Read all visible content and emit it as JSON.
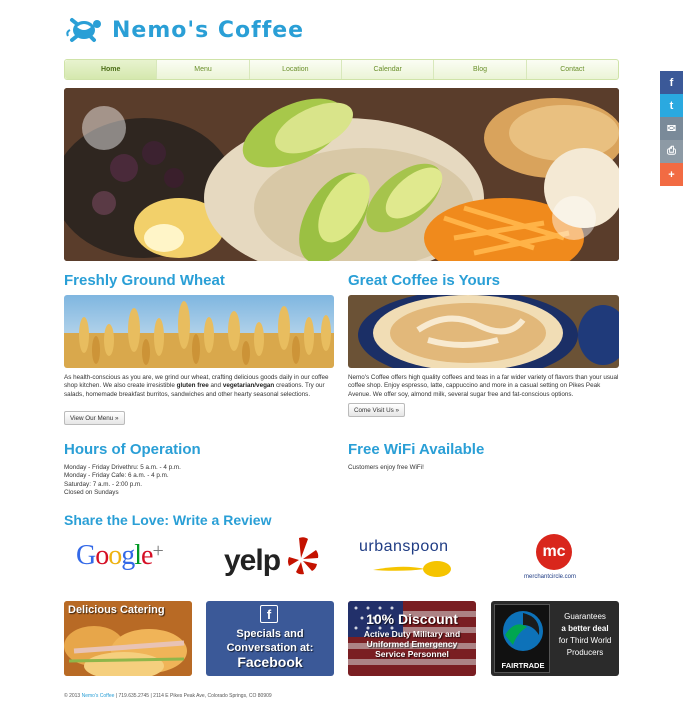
{
  "brand": {
    "name": "Nemo's Coffee",
    "accent": "#2a9fd6",
    "nav_green": "#6a8f2a"
  },
  "nav": {
    "items": [
      "Home",
      "Menu",
      "Location",
      "Calendar",
      "Blog",
      "Contact"
    ],
    "active": "Home"
  },
  "share": {
    "icons": [
      "facebook-icon",
      "twitter-icon",
      "email-icon",
      "print-icon",
      "plus-icon"
    ],
    "glyphs": [
      "f",
      "t",
      "✉",
      "⎙",
      "+"
    ]
  },
  "wheat": {
    "title": "Freshly Ground Wheat",
    "text_1": "As health-conscious as you are, we grind our wheat, crafting delicious goods daily in our coffee shop kitchen. We also create irresistible ",
    "bold_1": "gluten free",
    "text_2": " and ",
    "bold_2": "vegetarian/vegan",
    "text_3": " creations. Try our salads, homemade breakfast burritos, sandwiches and other hearty seasonal selections.",
    "button": "View Our Menu »"
  },
  "coffee": {
    "title": "Great Coffee is Yours",
    "text": "Nemo's Coffee offers high quality coffees and teas in a far wider variety of flavors than your usual coffee shop. Enjoy espresso, latte, cappuccino and more in a casual setting on Pikes Peak Avenue. We offer soy, almond milk, several sugar free and fat-conscious options.",
    "button": "Come Visit Us »"
  },
  "hours": {
    "title": "Hours of Operation",
    "lines": [
      "Monday - Friday Drivethru: 5 a.m. - 4 p.m.",
      "Monday - Friday Cafe: 6 a.m. - 4 p.m.",
      "Saturday: 7 a.m. - 2:00 p.m.",
      "Closed on Sundays"
    ]
  },
  "wifi": {
    "title": "Free WiFi Available",
    "text": "Customers enjoy free WiFi!"
  },
  "reviews": {
    "title": "Share the Love: Write a Review",
    "google": [
      "G",
      "o",
      "o",
      "g",
      "l",
      "e",
      "+"
    ],
    "yelp": "yelp",
    "urbanspoon": "urbanspoon",
    "mc": "mc",
    "merchantcircle": "merchantcircle.com"
  },
  "promos": {
    "catering": "Delicious Catering",
    "facebook_1": "Specials and",
    "facebook_2": "Conversation at:",
    "facebook_3": "Facebook",
    "discount_title": "10% Discount",
    "discount_lines": [
      "Active Duty Military and",
      "Uniformed Emergency",
      "Service Personnel"
    ],
    "fairtrade": "FAIRTRADE",
    "fairtrade_lines": [
      "Guarantees",
      "a better deal",
      "for Third World",
      "Producers"
    ]
  },
  "footer": {
    "copyright": "© 2013 ",
    "link": "Nemo's Coffee",
    "rest": " | 719.635.2745 | 2114 E Pikes Peak Ave, Colorado Springs, CO 80909"
  }
}
